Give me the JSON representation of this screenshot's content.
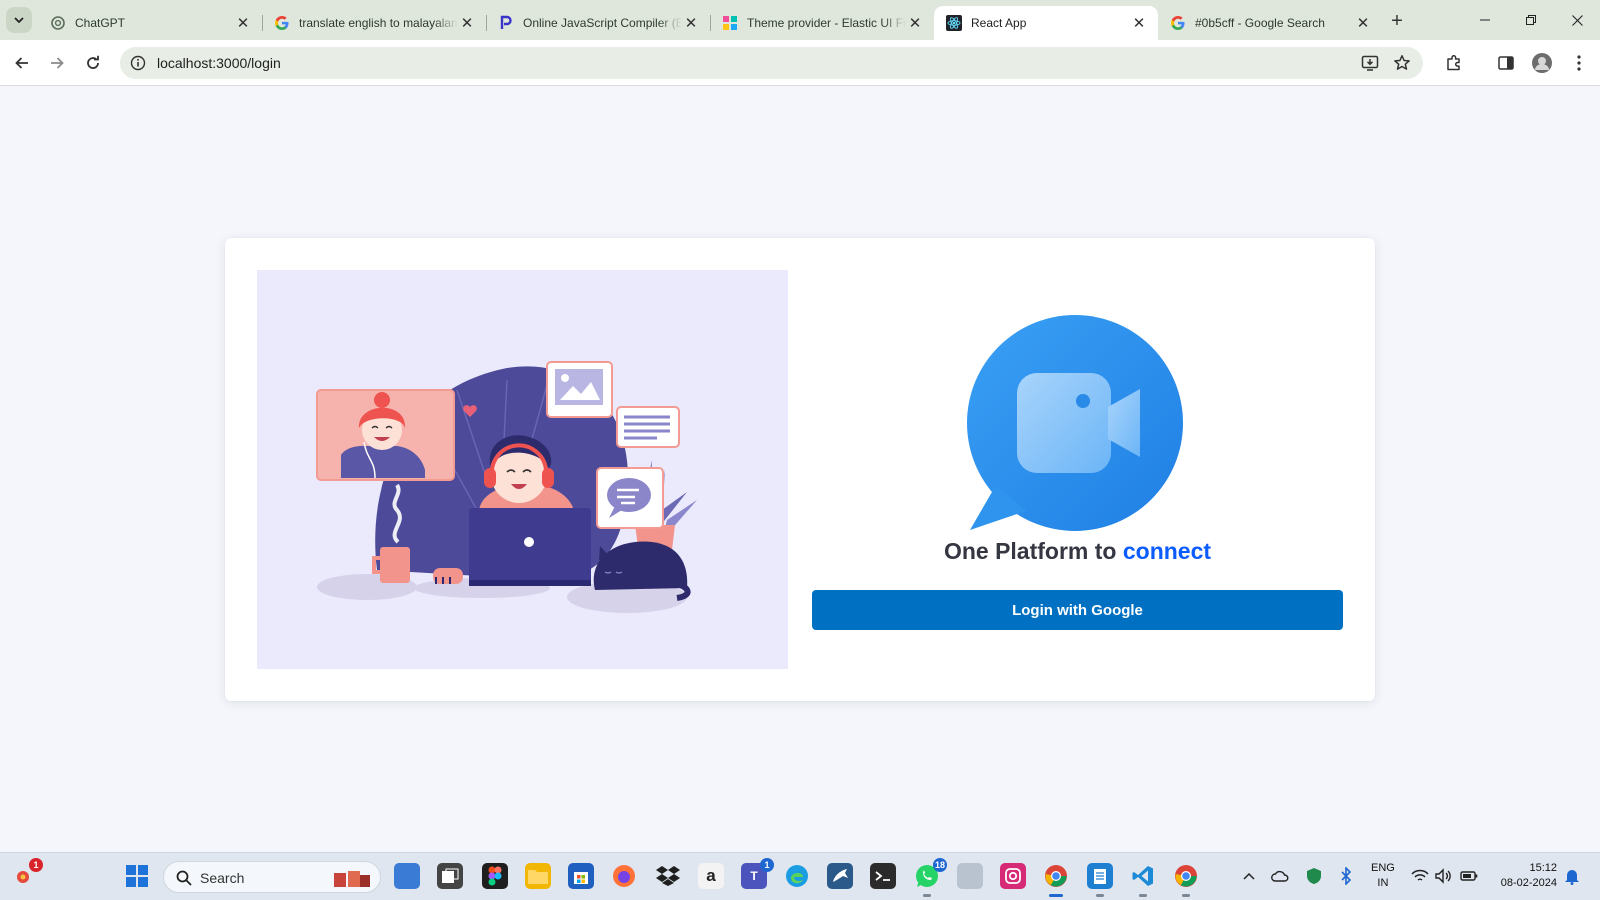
{
  "browser": {
    "tabs": [
      {
        "title": "ChatGPT",
        "favicon": "chatgpt-icon",
        "active": false
      },
      {
        "title": "translate english to malayalam",
        "favicon": "google-icon",
        "active": false
      },
      {
        "title": "Online JavaScript Compiler (Editor)",
        "favicon": "programiz-icon",
        "active": false
      },
      {
        "title": "Theme provider - Elastic UI Framework",
        "favicon": "elastic-icon",
        "active": false
      },
      {
        "title": "React App",
        "favicon": "react-icon",
        "active": true
      },
      {
        "title": "#0b5cff - Google Search",
        "favicon": "google-icon",
        "active": false
      }
    ],
    "url": "localhost:3000/login"
  },
  "page": {
    "tagline_prefix": "One Platform to",
    "tagline_accent": "connect",
    "login_button": "Login with Google",
    "accent_color": "#0b5cff",
    "button_color": "#0071c2"
  },
  "taskbar": {
    "search_label": "Search",
    "badges": {
      "notification": "1",
      "teams": "1",
      "whatsapp": "18"
    },
    "language_line1": "ENG",
    "language_line2": "IN",
    "time": "15:12",
    "date": "08-02-2024"
  }
}
